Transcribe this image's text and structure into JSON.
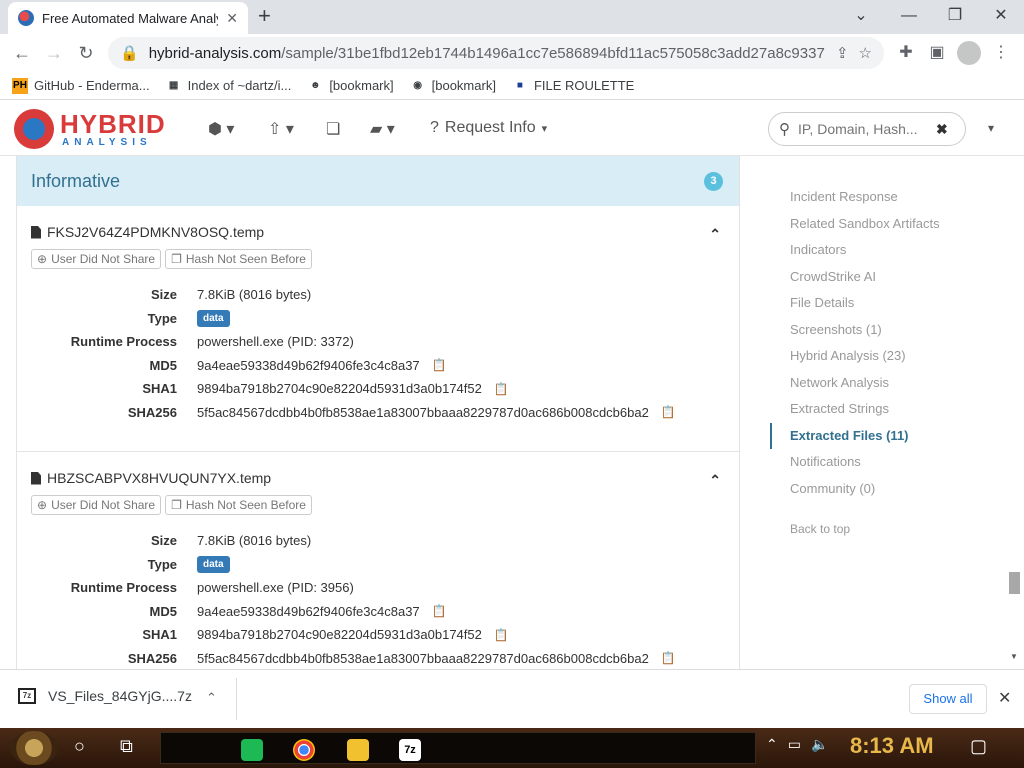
{
  "browser": {
    "tab_title": "Free Automated Malware Analy",
    "url_host": "hybrid-analysis.com",
    "url_path": "/sample/31be1fbd12eb1744b1496a1cc7e586894bfd11ac575058c3add27a8c9337..."
  },
  "bookmarks": [
    {
      "icon": "PH",
      "label": "GitHub - Enderma..."
    },
    {
      "icon": "▦",
      "label": "Index of ~dartz/i..."
    },
    {
      "icon": "☻",
      "label": "[bookmark]"
    },
    {
      "icon": "◉",
      "label": "[bookmark]"
    },
    {
      "icon": "■",
      "label": "FILE ROULETTE"
    }
  ],
  "site": {
    "logo_text": "HYBRID",
    "logo_sub": "ANALYSIS",
    "request_info": "Request Info",
    "search_placeholder": "IP, Domain, Hash..."
  },
  "panel": {
    "title": "Informative",
    "count": "3"
  },
  "tag_labels": {
    "share": "User Did Not Share",
    "hash": "Hash Not Seen Before"
  },
  "row_labels": {
    "size": "Size",
    "type": "Type",
    "runtime": "Runtime Process",
    "md5": "MD5",
    "sha1": "SHA1",
    "sha256": "SHA256"
  },
  "files": [
    {
      "name": "FKSJ2V64Z4PDMKNV8OSQ.temp",
      "size": "7.8KiB (8016 bytes)",
      "type": "data",
      "runtime": "powershell.exe (PID: 3372)",
      "md5": "9a4eae59338d49b62f9406fe3c4c8a37",
      "sha1": "9894ba7918b2704c90e82204d5931d3a0b174f52",
      "sha256": "5f5ac84567dcdbb4b0fb8538ae1a83007bbaaa8229787d0ac686b008cdcb6ba2"
    },
    {
      "name": "HBZSCABPVX8HVUQUN7YX.temp",
      "size": "7.8KiB (8016 bytes)",
      "type": "data",
      "runtime": "powershell.exe (PID: 3956)",
      "md5": "9a4eae59338d49b62f9406fe3c4c8a37",
      "sha1": "9894ba7918b2704c90e82204d5931d3a0b174f52",
      "sha256": "5f5ac84567dcdbb4b0fb8538ae1a83007bbaaa8229787d0ac686b008cdcb6ba2"
    }
  ],
  "sidebar": {
    "items": [
      "Incident Response",
      "Related Sandbox Artifacts",
      "Indicators",
      "CrowdStrike AI",
      "File Details",
      "Screenshots (1)",
      "Hybrid Analysis (23)",
      "Network Analysis",
      "Extracted Strings",
      "Extracted Files (11)",
      "Notifications",
      "Community (0)"
    ],
    "active_index": 9,
    "back": "Back to top"
  },
  "downloads": {
    "file": "VS_Files_84GYjG....7z",
    "show_all": "Show all"
  },
  "taskbar": {
    "clock": "8:13 AM"
  },
  "colors": {
    "panel_header_bg": "#d9edf7",
    "panel_title": "#31708f",
    "badge": "#5bc0de",
    "type_badge": "#337ab7",
    "logo_red": "#d93a3a",
    "logo_blue": "#2a77c4",
    "clock": "#e8b84a"
  }
}
